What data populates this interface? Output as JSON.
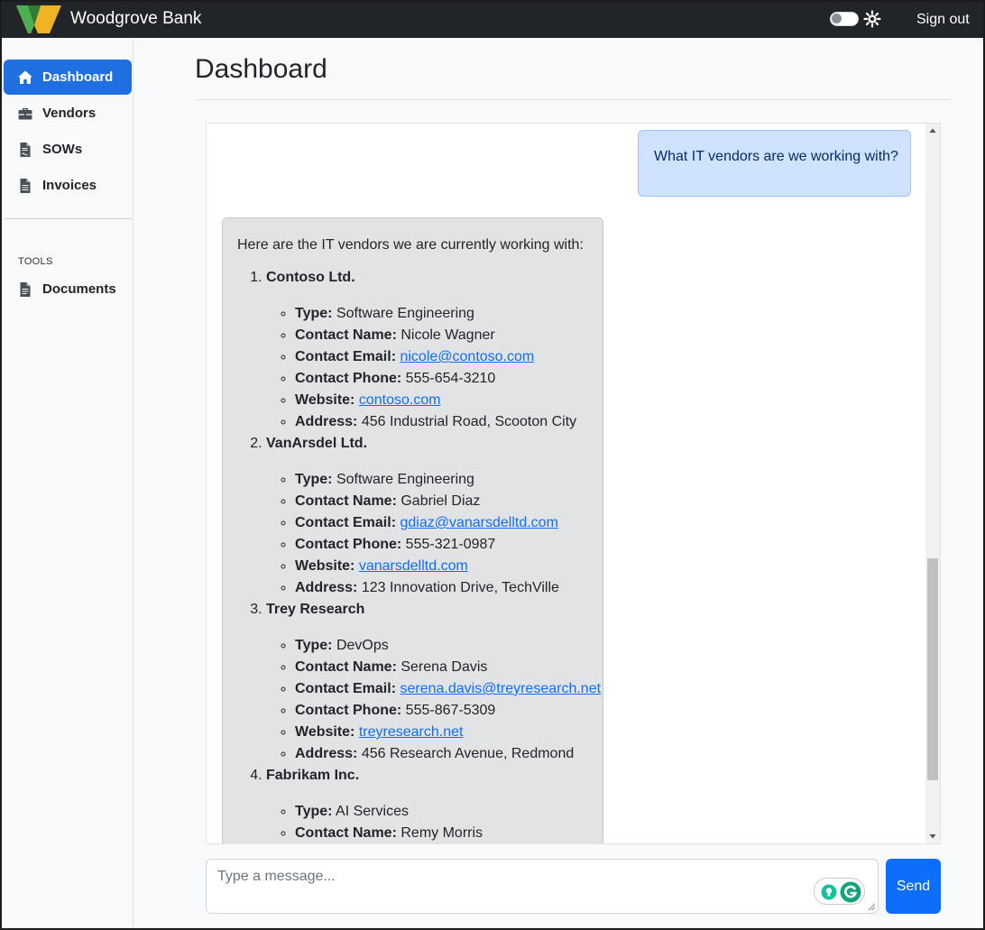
{
  "header": {
    "brand": "Woodgrove Bank",
    "sign_out": "Sign out"
  },
  "sidebar": {
    "items": [
      {
        "label": "Dashboard",
        "icon": "home-icon",
        "active": true
      },
      {
        "label": "Vendors",
        "icon": "briefcase-icon"
      },
      {
        "label": "SOWs",
        "icon": "file-contract-icon"
      },
      {
        "label": "Invoices",
        "icon": "file-invoice-icon"
      }
    ],
    "tools_label": "TOOLS",
    "tools_items": [
      {
        "label": "Documents",
        "icon": "file-icon"
      }
    ]
  },
  "main": {
    "title": "Dashboard"
  },
  "chat": {
    "user_message": "What IT vendors are we working with?",
    "bot_intro": "Here are the IT vendors we are currently working with:",
    "labels": {
      "type": "Type:",
      "contact_name": "Contact Name:",
      "contact_email": "Contact Email:",
      "contact_phone": "Contact Phone:",
      "website": "Website:",
      "address": "Address:"
    },
    "vendors": [
      {
        "name": "Contoso Ltd.",
        "type": "Software Engineering",
        "contact_name": "Nicole Wagner",
        "email": "nicole@contoso.com",
        "phone": "555-654-3210",
        "website": "contoso.com",
        "address": "456 Industrial Road, Scooton City"
      },
      {
        "name": "VanArsdel Ltd.",
        "type": "Software Engineering",
        "contact_name": "Gabriel Diaz",
        "email": "gdiaz@vanarsdelltd.com",
        "phone": "555-321-0987",
        "website": "vanarsdelltd.com",
        "address": "123 Innovation Drive, TechVille"
      },
      {
        "name": "Trey Research",
        "type": "DevOps",
        "contact_name": "Serena Davis",
        "email": "serena.davis@treyresearch.net",
        "phone": "555-867-5309",
        "website": "treyresearch.net",
        "address": "456 Research Avenue, Redmond"
      },
      {
        "name": "Fabrikam Inc.",
        "type": "AI Services",
        "contact_name": "Remy Morris"
      }
    ]
  },
  "composer": {
    "placeholder": "Type a message...",
    "send_label": "Send"
  },
  "colors": {
    "accent": "#0d6efd",
    "topbar": "#212529",
    "user_bubble": "#cfe2ff",
    "bot_bubble": "#e2e3e5"
  }
}
